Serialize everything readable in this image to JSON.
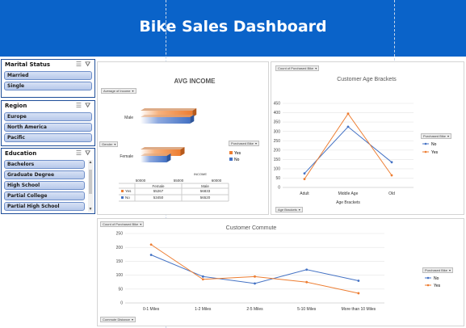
{
  "header": {
    "title": "Bike Sales Dashboard"
  },
  "slicers": {
    "marital_status": {
      "title": "Marital Status",
      "items": [
        "Married",
        "Single"
      ]
    },
    "region": {
      "title": "Region",
      "items": [
        "Europe",
        "North America",
        "Pacific"
      ]
    },
    "education": {
      "title": "Education",
      "items": [
        "Bachelors",
        "Graduate Degree",
        "High School",
        "Partial College",
        "Partial High School"
      ]
    }
  },
  "income_panel": {
    "value_button": "Average of Income",
    "axis_button": "Gender",
    "legend_button": "Purchased Bike",
    "table": {
      "headers": [
        "Female",
        "Male"
      ],
      "rows": [
        {
          "label": "Yes",
          "values": [
            "55267",
            "56833"
          ]
        },
        {
          "label": "No",
          "values": [
            "53450",
            "56520"
          ]
        }
      ]
    }
  },
  "age_panel": {
    "value_button": "Count of Purchased Bike",
    "axis_button": "Age Brackets",
    "legend_button": "Purchased Bike"
  },
  "commute_panel": {
    "value_button": "Count of Purchased Bike",
    "axis_button": "Commute Distance",
    "legend_button": "Purchased Bike"
  },
  "colors": {
    "banner": "#0a63c9",
    "no": "#4472c4",
    "yes": "#ed7d31",
    "slicer_border": "#1f4e99"
  },
  "icons": [
    "multi-select-icon",
    "clear-filter-icon"
  ],
  "chart_data": [
    {
      "type": "bar",
      "title": "AVG INCOME",
      "xlabel": "INCOME",
      "categories": [
        "Female",
        "Male"
      ],
      "series": [
        {
          "name": "No",
          "values": [
            53450,
            56520
          ]
        },
        {
          "name": "Yes",
          "values": [
            55267,
            56833
          ]
        }
      ],
      "xlim": [
        50000,
        60000
      ],
      "ticks": [
        "50000",
        "55000",
        "60000"
      ],
      "legend": "right"
    },
    {
      "type": "line",
      "title": "Customer Age Brackets",
      "xlabel": "Age Brackets",
      "categories": [
        "Adult",
        "Middle Age",
        "Old"
      ],
      "series": [
        {
          "name": "No",
          "values": [
            75,
            325,
            135
          ]
        },
        {
          "name": "Yes",
          "values": [
            45,
            395,
            65
          ]
        }
      ],
      "ylim": [
        0,
        450
      ],
      "yticks": [
        "0",
        "50",
        "100",
        "150",
        "200",
        "250",
        "300",
        "350",
        "400",
        "450"
      ],
      "grid": true,
      "legend": "right"
    },
    {
      "type": "line",
      "title": "Customer Commute",
      "categories": [
        "0-1 Miles",
        "1-2 Miles",
        "2-5 Miles",
        "5-10 Miles",
        "More than 10 Miles"
      ],
      "series": [
        {
          "name": "No",
          "values": [
            173,
            95,
            70,
            120,
            80
          ]
        },
        {
          "name": "Yes",
          "values": [
            210,
            85,
            95,
            75,
            35
          ]
        }
      ],
      "ylim": [
        0,
        250
      ],
      "yticks": [
        "0",
        "50",
        "100",
        "150",
        "200",
        "250"
      ],
      "grid": true,
      "legend": "right"
    }
  ]
}
